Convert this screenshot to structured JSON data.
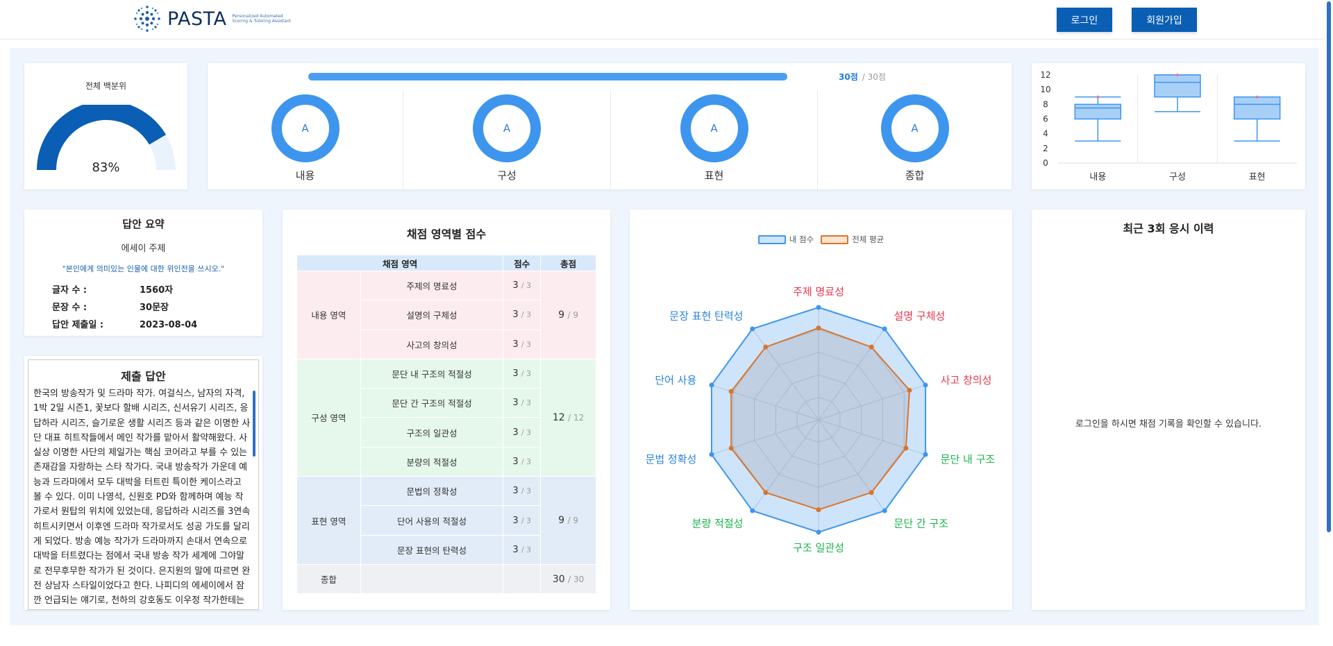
{
  "brand": {
    "name": "PASTA",
    "tagline": "Personalized Automated Scoring & Tutoring Assistant"
  },
  "auth": {
    "login": "로그인",
    "signup": "회원가입"
  },
  "percentile": {
    "title": "전체 백분위",
    "value": "83%",
    "fraction": 0.83
  },
  "score_bar": {
    "score": "30점",
    "total": "/ 30점",
    "fraction": 1.0
  },
  "grades": [
    {
      "grade": "A",
      "label": "내용"
    },
    {
      "grade": "A",
      "label": "구성"
    },
    {
      "grade": "A",
      "label": "표현"
    },
    {
      "grade": "A",
      "label": "종합"
    }
  ],
  "summary": {
    "title": "답안 요약",
    "topic_label": "에세이 주제",
    "topic": "\"본인에게 의미있는 인물에 대한 위인전을 쓰시오.\"",
    "rows": [
      {
        "key": "글자 수 :",
        "val": "1560자"
      },
      {
        "key": "문장 수 :",
        "val": "30문장"
      },
      {
        "key": "답안 제출일 :",
        "val": "2023-08-04"
      }
    ]
  },
  "answer": {
    "title": "제출 답안",
    "text": "한국의 방송작가 및 드라마 작가. 여걸식스, 남자의 자격, 1박 2일 시즌1, 꽃보다 할배 시리즈, 신서유기 시리즈, 응답하라 시리즈, 슬기로운 생활 시리즈 등과 같은 이명한 사단 대표 히트작들에서 메인 작가를 맡아서 활약해왔다. 사실상 이명한 사단의 제일가는 핵심 코어라고 부를 수 있는 존재감을 자랑하는 스타 작가다. 국내 방송작가 가운데 예능과 드라마에서 모두 대박을 터트린 특이한 케이스라고 볼 수 있다. 이미 나영석, 신원호 PD와 함께하며 예능 작가로서 원탑의 위치에 있었는데, 응답하라 시리즈를 3연속 히트시키면서 이후엔 드라마 작가로서도 성공 가도를 달리게 되었다. 방송 예능 작가가 드라마까지 손대서 연속으로 대박을 터트렸다는 점에서 국내 방송 작가 세계에 그야말로 전무후무한 작가가 된 것이다. 은지원의 말에 따르면 완전 상남자 스타일이었다고 한다. 나피디의 에세이에서 잠깐 언급되는 얘기로, 천하의 강호동도 이우정 작가한테는 꼼"
  },
  "table": {
    "title": "채점 영역별 점수",
    "headers": [
      "채점 영역",
      "점수",
      "총점"
    ],
    "groups": [
      {
        "name": "내용 영역",
        "total": "9",
        "max": "/ 9",
        "items": [
          {
            "name": "주제의 명료성",
            "score": "3",
            "max": "/ 3"
          },
          {
            "name": "설명의 구체성",
            "score": "3",
            "max": "/ 3"
          },
          {
            "name": "사고의 창의성",
            "score": "3",
            "max": "/ 3"
          }
        ]
      },
      {
        "name": "구성 영역",
        "total": "12",
        "max": "/ 12",
        "items": [
          {
            "name": "문단 내 구조의 적절성",
            "score": "3",
            "max": "/ 3"
          },
          {
            "name": "문단 간 구조의 적절성",
            "score": "3",
            "max": "/ 3"
          },
          {
            "name": "구조의 일관성",
            "score": "3",
            "max": "/ 3"
          },
          {
            "name": "분량의 적절성",
            "score": "3",
            "max": "/ 3"
          }
        ]
      },
      {
        "name": "표현 영역",
        "total": "9",
        "max": "/ 9",
        "items": [
          {
            "name": "문법의 정확성",
            "score": "3",
            "max": "/ 3"
          },
          {
            "name": "단어 사용의 적절성",
            "score": "3",
            "max": "/ 3"
          },
          {
            "name": "문장 표현의 탄력성",
            "score": "3",
            "max": "/ 3"
          }
        ]
      }
    ],
    "total_label": "종합",
    "total": "30",
    "total_max": "/ 30"
  },
  "chart_data": [
    {
      "type": "boxplot",
      "categories": [
        "내용",
        "구성",
        "표현"
      ],
      "ylim": [
        0,
        12
      ],
      "yticks": [
        0,
        2,
        4,
        6,
        8,
        10,
        12
      ],
      "boxes": [
        {
          "min": 3,
          "q1": 6,
          "median": 7.5,
          "q3": 8,
          "max": 9,
          "point": 9
        },
        {
          "min": 7,
          "q1": 9,
          "median": 11,
          "q3": 12,
          "max": 12,
          "point": 12
        },
        {
          "min": 3,
          "q1": 6,
          "median": 8,
          "q3": 9,
          "max": 9,
          "point": 9
        }
      ],
      "colors": {
        "box": "#a8d0f7",
        "stroke": "#3d95ee",
        "point": "#f07b7b"
      }
    },
    {
      "type": "radar",
      "axes": [
        "주제 명료성",
        "설명 구체성",
        "사고 창의성",
        "문단 내 구조",
        "문단 간 구조",
        "구조 일관성",
        "분량 적절성",
        "문법 정확성",
        "단어 사용",
        "문장 표현 탄력성"
      ],
      "axis_colors": [
        "#e8374f",
        "#e8374f",
        "#e8374f",
        "#19b44c",
        "#19b44c",
        "#19b44c",
        "#19b44c",
        "#2a83dc",
        "#2a83dc",
        "#2a83dc"
      ],
      "max": 3,
      "series": [
        {
          "name": "내 점수",
          "values": [
            3,
            3,
            3,
            3,
            3,
            3,
            3,
            3,
            3,
            3
          ],
          "color": "#3d95ee"
        },
        {
          "name": "전체 평균",
          "values": [
            2.45,
            2.4,
            2.55,
            2.45,
            2.4,
            2.4,
            2.4,
            2.45,
            2.45,
            2.4
          ],
          "color": "#d9752c"
        }
      ]
    }
  ],
  "history": {
    "title": "최근 3회 응시 이력",
    "message": "로그인을 하시면 채점 기록을 확인할 수 있습니다."
  }
}
